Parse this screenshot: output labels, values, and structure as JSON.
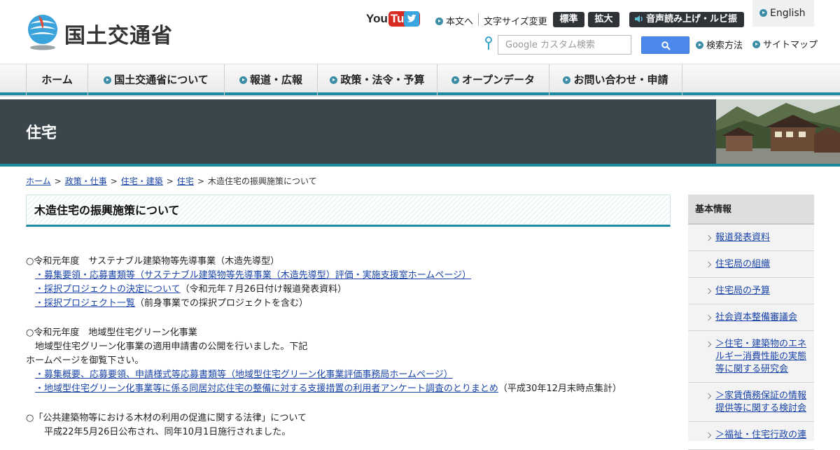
{
  "header": {
    "logo_text": "国土交通省",
    "youtube": {
      "you": "You",
      "tube": "Tube"
    },
    "honbun": "本文へ",
    "font_size_label": "文字サイズ変更",
    "font_standard": "標準",
    "font_large": "拡大",
    "voice": "音声読み上げ・ルビ振り",
    "english": "English",
    "search_placeholder": "Google カスタム検索",
    "search_howto": "検索方法",
    "sitemap": "サイトマップ"
  },
  "nav": {
    "items": [
      "ホーム",
      "国土交通省について",
      "報道・広報",
      "政策・法令・予算",
      "オープンデータ",
      "お問い合わせ・申請"
    ]
  },
  "banner": {
    "title": "住宅"
  },
  "breadcrumb": {
    "items": [
      "ホーム",
      "政策・仕事",
      "住宅・建築",
      "住宅"
    ],
    "current": "木造住宅の振興施策について",
    "separator": ">"
  },
  "main": {
    "title": "木造住宅の振興施策について",
    "s1_head": "○令和元年度　サステナブル建築物等先導事業（木造先導型）",
    "s1_link1": "・募集要領・応募書類等（サステナブル建築物等先導事業（木造先導型）評価・実施支援室ホームページ）",
    "s1_link2": "・採択プロジェクトの決定について",
    "s1_link2_note": "（令和元年７月26日付け報道発表資料）",
    "s1_link3": "・採択プロジェクト一覧",
    "s1_link3_note": "（前身事業での採択プロジェクトを含む）",
    "s2_head": "○令和元年度　地域型住宅グリーン化事業",
    "s2_text1": "地域型住宅グリーン化事業の適用申請書の公開を行いました。下記",
    "s2_text2": "ホームページを御覧下さい。",
    "s2_link1": "・募集概要、応募要領、申請様式等応募書類等（地域型住宅グリーン化事業評価事務局ホームページ）",
    "s2_link2": "・地域型住宅グリーン化事業等に係る同居対応住宅の整備に対する支援措置の利用者アンケート調査のとりまとめ",
    "s2_link2_note": "（平成30年12月末時点集計）",
    "s3_head": "○「公共建築物等における木材の利用の促進に関する法律」について",
    "s3_text1": "平成22年5月26日公布され、同年10月1日施行されました。"
  },
  "side": {
    "title": "基本情報",
    "items": [
      "報道発表資料",
      "住宅局の組織",
      "住宅局の予算",
      "社会資本整備審議会",
      "＞住宅・建築物のエネルギー消費性能の実態等に関する研究会",
      "＞家賃債務保証の情報提供等に関する検討会",
      "＞福祉・住宅行政の連"
    ]
  },
  "colors": {
    "accent": "#1e8aa0",
    "banner": "#3a454c",
    "link": "#1a44a8"
  }
}
